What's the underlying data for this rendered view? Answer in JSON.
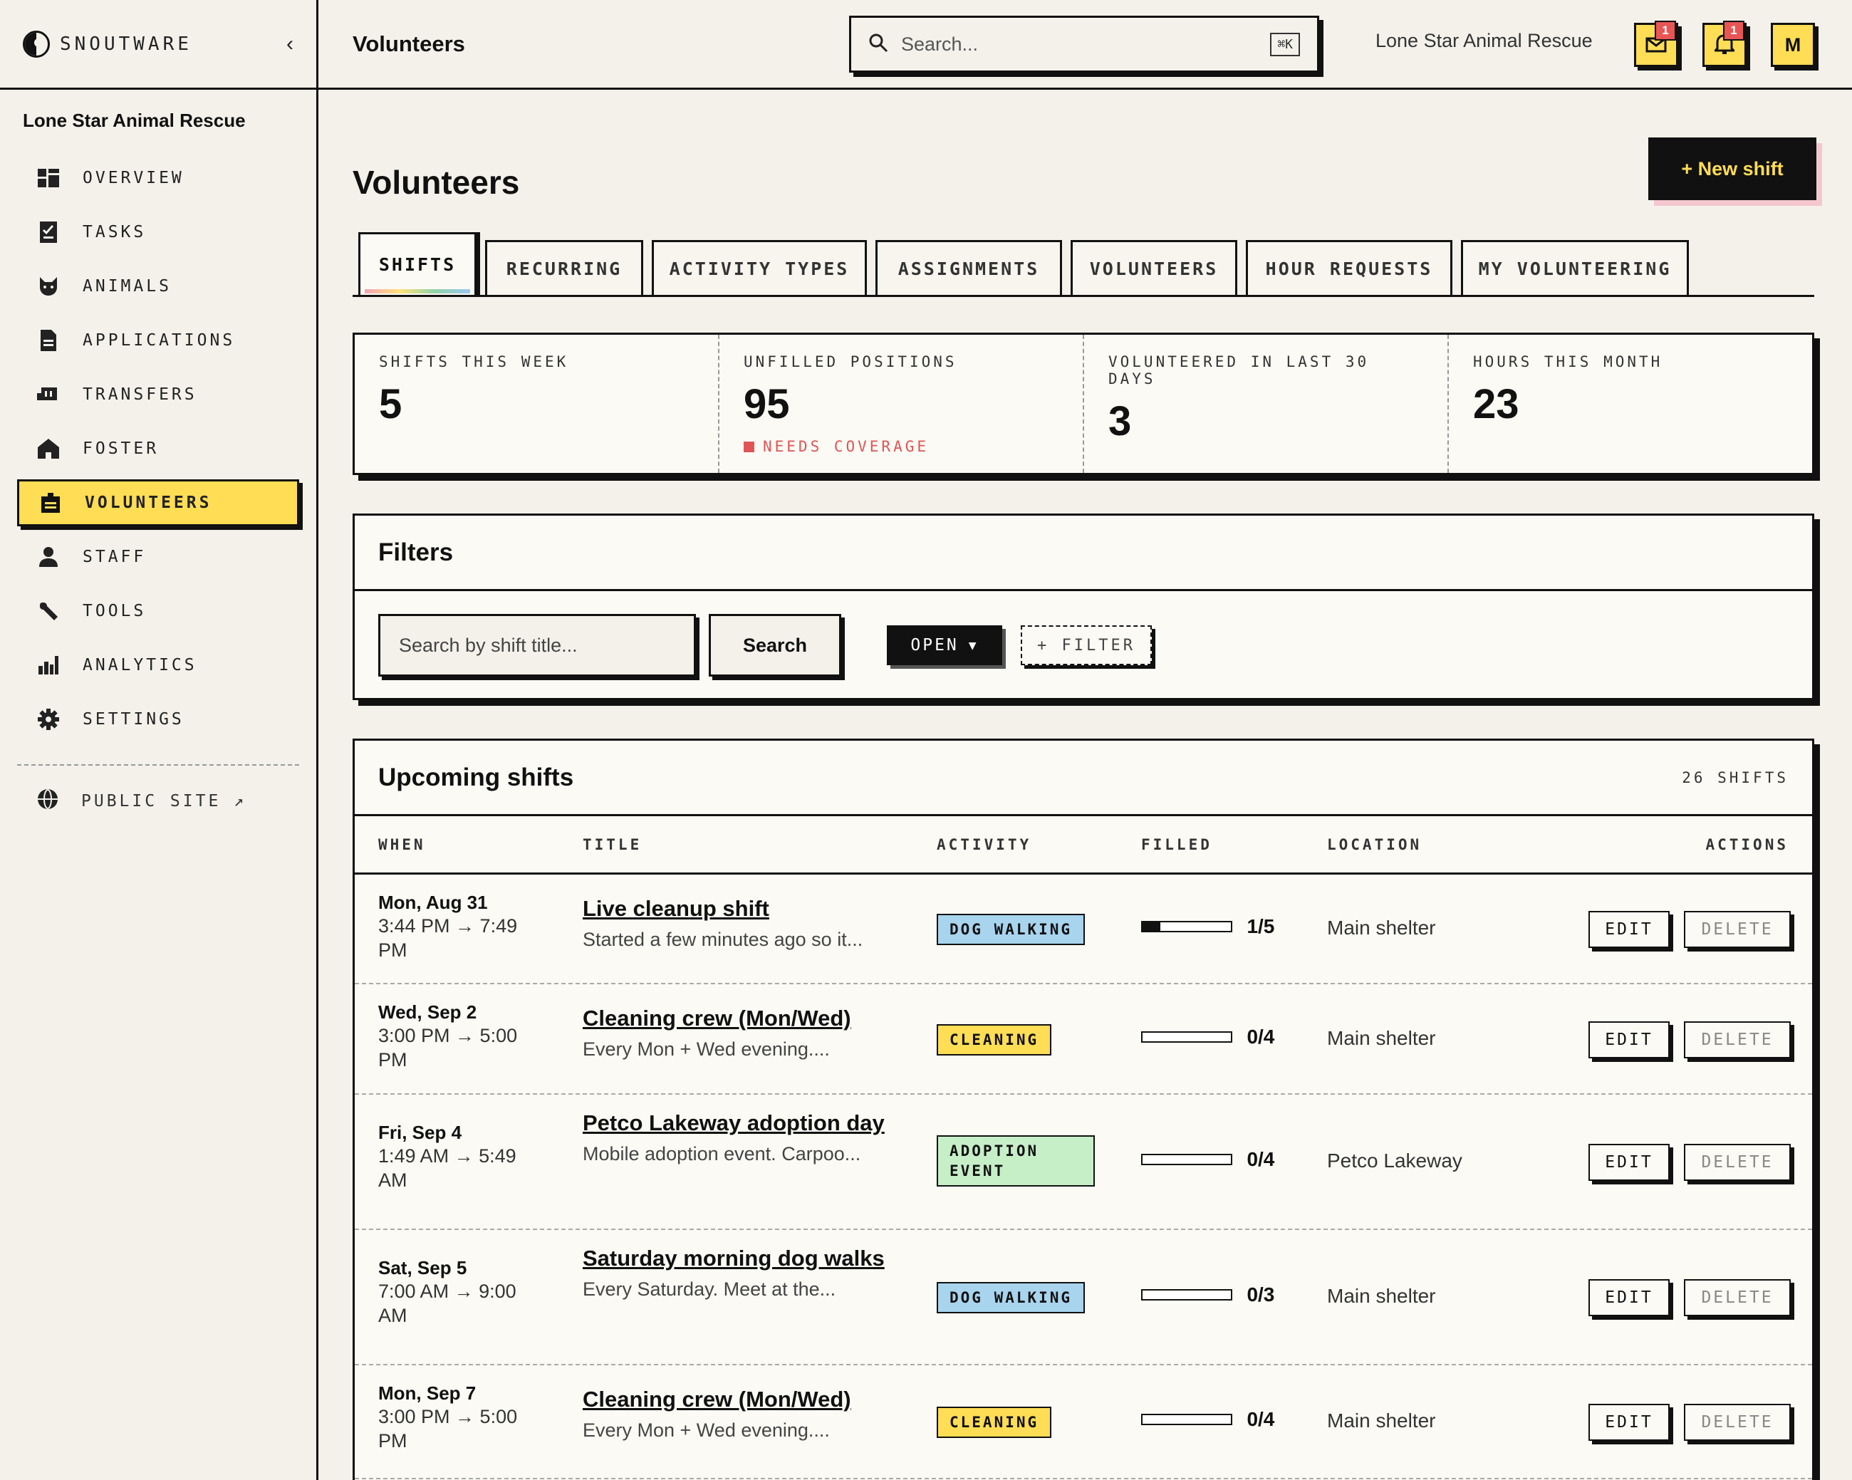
{
  "app": {
    "brand": "SNOUTWARE",
    "org_name": "Lone Star Animal Rescue"
  },
  "sidebar": {
    "items": [
      {
        "label": "OVERVIEW",
        "icon": "dashboard-icon"
      },
      {
        "label": "TASKS",
        "icon": "checklist-icon"
      },
      {
        "label": "ANIMALS",
        "icon": "cat-icon"
      },
      {
        "label": "APPLICATIONS",
        "icon": "document-icon"
      },
      {
        "label": "TRANSFERS",
        "icon": "truck-icon"
      },
      {
        "label": "FOSTER",
        "icon": "home-icon"
      },
      {
        "label": "VOLUNTEERS",
        "icon": "badge-icon",
        "active": true
      },
      {
        "label": "STAFF",
        "icon": "person-icon"
      },
      {
        "label": "TOOLS",
        "icon": "wrench-icon"
      },
      {
        "label": "ANALYTICS",
        "icon": "bar-chart-icon"
      },
      {
        "label": "SETTINGS",
        "icon": "gear-icon"
      }
    ],
    "public_site": "PUBLIC SITE ↗"
  },
  "header": {
    "title": "Volunteers",
    "search_placeholder": "Search...",
    "search_shortcut": "⌘K",
    "org_name": "Lone Star Animal Rescue",
    "inbox_badge": "1",
    "notifications_badge": "1",
    "avatar_initial": "M"
  },
  "page": {
    "title": "Volunteers",
    "new_shift_label": "+ New shift",
    "tabs": [
      "SHIFTS",
      "RECURRING",
      "ACTIVITY TYPES",
      "ASSIGNMENTS",
      "VOLUNTEERS",
      "HOUR REQUESTS",
      "MY VOLUNTEERING"
    ],
    "active_tab": "SHIFTS"
  },
  "stats": [
    {
      "label": "SHIFTS THIS WEEK",
      "value": "5"
    },
    {
      "label": "UNFILLED POSITIONS",
      "value": "95",
      "note": "NEEDS COVERAGE"
    },
    {
      "label": "VOLUNTEERED IN LAST 30 DAYS",
      "value": "3"
    },
    {
      "label": "HOURS THIS MONTH",
      "value": "23"
    }
  ],
  "filters": {
    "title": "Filters",
    "search_placeholder": "Search by shift title...",
    "search_button": "Search",
    "status_select": "OPEN",
    "add_filter": "+ FILTER"
  },
  "shifts": {
    "title": "Upcoming shifts",
    "count_label": "26 SHIFTS",
    "columns": [
      "WHEN",
      "TITLE",
      "ACTIVITY",
      "FILLED",
      "LOCATION",
      "ACTIONS"
    ],
    "edit_label": "EDIT",
    "delete_label": "DELETE",
    "rows": [
      {
        "date": "Mon, Aug 31",
        "time": "3:44 PM → 7:49 PM",
        "title": "Live cleanup shift",
        "desc": "Started a few minutes ago so it...",
        "activity": "DOG WALKING",
        "activity_color": "blue",
        "filled": "1/5",
        "filled_fraction": 0.2,
        "location": "Main shelter"
      },
      {
        "date": "Wed, Sep 2",
        "time": "3:00 PM → 5:00 PM",
        "title": "Cleaning crew (Mon/Wed)",
        "desc": "Every Mon + Wed evening....",
        "activity": "CLEANING",
        "activity_color": "yellow",
        "filled": "0/4",
        "filled_fraction": 0,
        "location": "Main shelter"
      },
      {
        "date": "Fri, Sep 4",
        "time": "1:49 AM → 5:49 AM",
        "title": "Petco Lakeway adoption day",
        "desc": "Mobile adoption event. Carpoo...",
        "activity": "ADOPTION EVENT",
        "activity_color": "green",
        "filled": "0/4",
        "filled_fraction": 0,
        "location": "Petco Lakeway"
      },
      {
        "date": "Sat, Sep 5",
        "time": "7:00 AM → 9:00 AM",
        "title": "Saturday morning dog walks",
        "desc": "Every Saturday. Meet at the...",
        "activity": "DOG WALKING",
        "activity_color": "blue",
        "filled": "0/3",
        "filled_fraction": 0,
        "location": "Main shelter"
      },
      {
        "date": "Mon, Sep 7",
        "time": "3:00 PM → 5:00 PM",
        "title": "Cleaning crew (Mon/Wed)",
        "desc": "Every Mon + Wed evening....",
        "activity": "CLEANING",
        "activity_color": "yellow",
        "filled": "0/4",
        "filled_fraction": 0,
        "location": "Main shelter"
      }
    ]
  }
}
